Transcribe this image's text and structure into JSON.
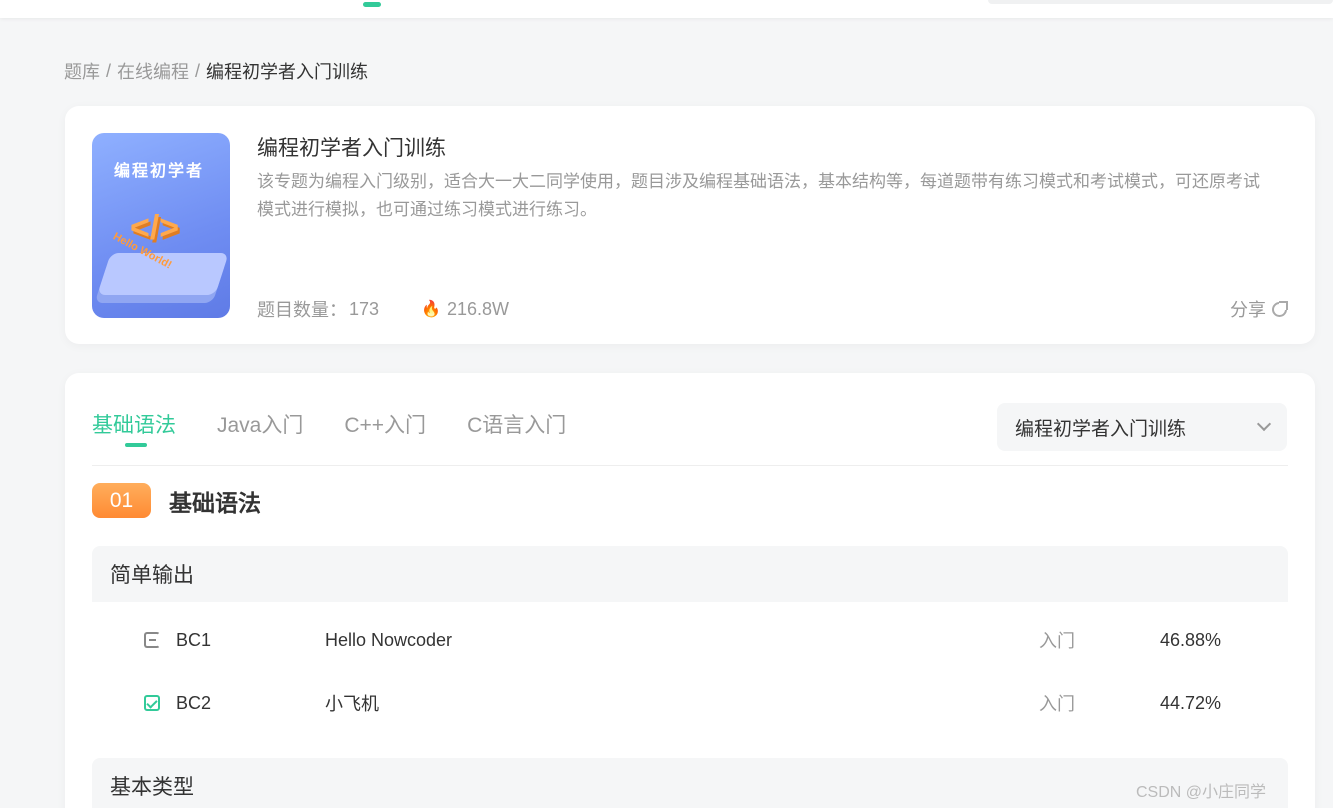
{
  "breadcrumb": {
    "items": [
      "题库",
      "在线编程",
      "编程初学者入门训练"
    ],
    "separator": "/"
  },
  "intro": {
    "cover_text": "编程初学者",
    "cover_code": "</>",
    "cover_hello": "Hello World!",
    "title": "编程初学者入门训练",
    "description": "该专题为编程入门级别，适合大一大二同学使用，题目涉及编程基础语法，基本结构等，每道题带有练习模式和考试模式，可还原考试模式进行模拟，也可通过练习模式进行练习。",
    "count_label": "题目数量：",
    "count_value": "173",
    "hot_value": "216.8W",
    "share_label": "分享"
  },
  "tabs": [
    {
      "label": "基础语法",
      "active": true
    },
    {
      "label": "Java入门",
      "active": false
    },
    {
      "label": "C++入门",
      "active": false
    },
    {
      "label": "C语言入门",
      "active": false
    }
  ],
  "select": {
    "value": "编程初学者入门训练"
  },
  "section": {
    "number": "01",
    "title": "基础语法"
  },
  "groups": [
    {
      "title": "简单输出",
      "rows": [
        {
          "code": "BC1",
          "name": "Hello Nowcoder",
          "level": "入门",
          "rate": "46.88%",
          "status": "todo"
        },
        {
          "code": "BC2",
          "name": "小飞机",
          "level": "入门",
          "rate": "44.72%",
          "status": "done"
        }
      ]
    },
    {
      "title": "基本类型",
      "rows": []
    }
  ],
  "watermark": "CSDN @小庄同学"
}
